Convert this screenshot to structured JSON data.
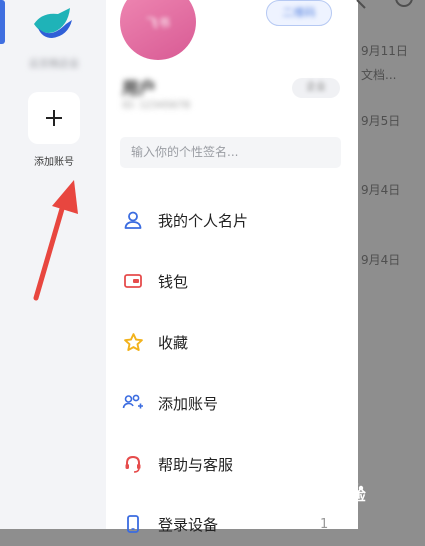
{
  "account_rail": {
    "account_name": "云文档企业",
    "add_account_label": "添加账号"
  },
  "profile": {
    "avatar_text": "飞书",
    "top_button_label": "二维码",
    "user_name": "用户",
    "user_id": "ID: 12345678",
    "org_badge": "企业",
    "signature_placeholder": "输入你的个性签名..."
  },
  "menu": {
    "items": [
      {
        "label": "我的个人名片",
        "icon": "person-icon",
        "color": "#3b6ce0"
      },
      {
        "label": "钱包",
        "icon": "wallet-icon",
        "color": "#e64c4c"
      },
      {
        "label": "收藏",
        "icon": "star-icon",
        "color": "#f2b21b"
      },
      {
        "label": "添加账号",
        "icon": "add-people-icon",
        "color": "#3b6ce0"
      },
      {
        "label": "帮助与客服",
        "icon": "headset-icon",
        "color": "#e64c4c"
      },
      {
        "label": "登录设备",
        "icon": "phone-icon",
        "color": "#3b6ce0"
      }
    ],
    "device_count": "1"
  },
  "background": {
    "dates": [
      "9月11日",
      "9月5日",
      "9月4日",
      "9月4日"
    ],
    "docs_text": "文档..."
  },
  "watermark": {
    "text": "Bai经验"
  },
  "colors": {
    "accent": "#3f6fe0",
    "annotation": "#e8463f"
  }
}
